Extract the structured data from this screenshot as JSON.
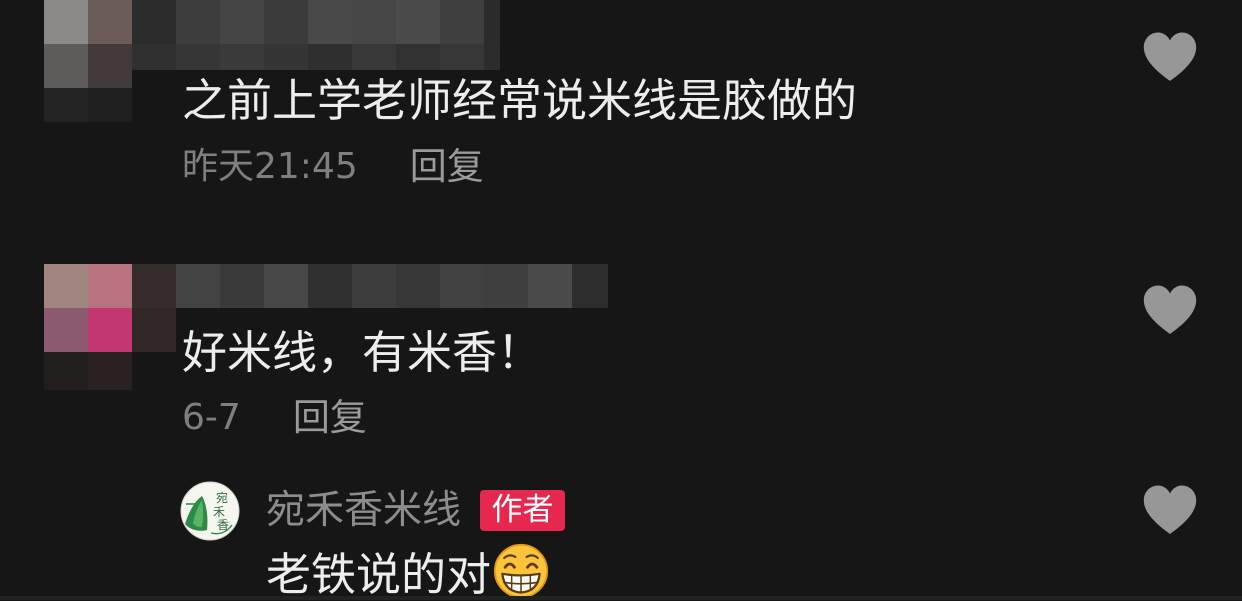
{
  "theme": {
    "background": "#161616",
    "text": "#ededed",
    "meta": "#7f7f7f",
    "reply_link": "#9b9b9b",
    "author_name": "#8d8d8d",
    "heart": "#979797",
    "badge_bg": "#e8274e",
    "badge_text": "#ffffff"
  },
  "comments": [
    {
      "avatar_mosaic": [
        [
          "#8b8a88",
          "#6b5c57"
        ],
        [
          "#5d5c5a",
          "#41393a"
        ],
        [
          "#232323",
          "#1f1f1f"
        ]
      ],
      "name_mosaic": [
        [
          "#2c2c2c",
          "#3d3d3d",
          "#454545",
          "#3b3b3b",
          "#494949",
          "#464646",
          "#4b4b4b",
          "#3f3f3f",
          "#2b2b2b"
        ],
        [
          "#303030",
          "#363636",
          "#3a3a3a",
          "#353535",
          "#2f2f2f",
          "#383838",
          "#313131",
          "#373737",
          "#2c2c2c"
        ]
      ],
      "text": "之前上学老师经常说米线是胶做的",
      "time": "昨天21:45",
      "reply_label": "回复",
      "like_icon": "heart-icon"
    },
    {
      "avatar_mosaic": [
        [
          "#a2847e",
          "#b9737f",
          "#352d2b"
        ],
        [
          "#8e5a72",
          "#c2376f",
          "#2f2826"
        ],
        [
          "#231e1e",
          "#2a2222",
          "transparent"
        ]
      ],
      "name_mosaic": [
        [
          "#434343",
          "#3a3a3a",
          "#474747",
          "#303030",
          "#3c3c3c",
          "#373737",
          "#414141",
          "#3f3f3f",
          "#4b4b4b",
          "#2d2d2d"
        ]
      ],
      "text": "好米线，有米香！",
      "time": "6-7",
      "reply_label": "回复",
      "like_icon": "heart-icon"
    }
  ],
  "author_reply": {
    "avatar_logo_chars": [
      "宛",
      "禾",
      "香"
    ],
    "username": "宛禾香米线",
    "badge": "作者",
    "text": "老铁说的对",
    "emoji": "grin-emoji",
    "like_icon": "heart-icon"
  }
}
